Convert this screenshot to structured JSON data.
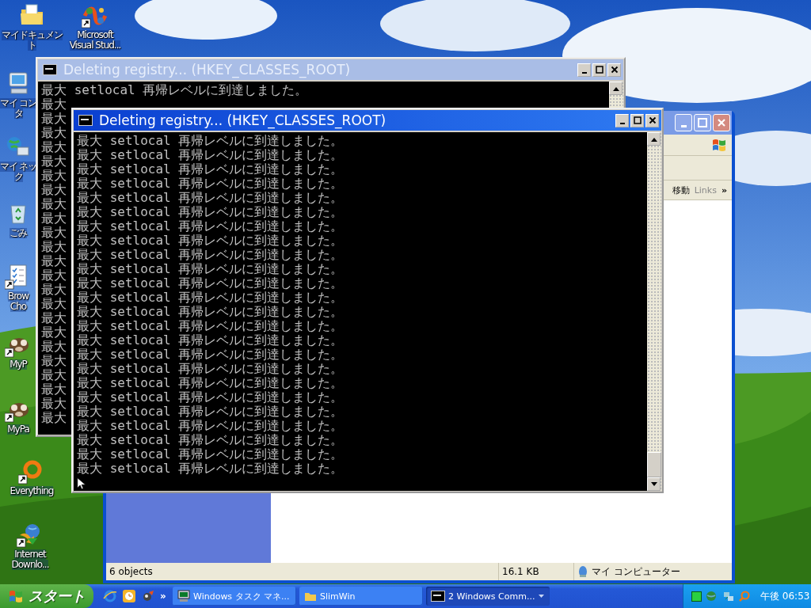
{
  "desktop_icons": [
    {
      "kind": "documents",
      "shortcut": false,
      "label_lines": [
        "マイドキュメン",
        "ト"
      ]
    },
    {
      "kind": "visual_studio",
      "shortcut": true,
      "label_lines": [
        "Microsoft",
        "Visual Stud..."
      ]
    },
    {
      "kind": "computer",
      "shortcut": false,
      "label_lines": [
        "マイ コン",
        "タ"
      ]
    },
    {
      "kind": "network",
      "shortcut": false,
      "label_lines": [
        "マイ ネッ",
        "ク"
      ]
    },
    {
      "kind": "recycle",
      "shortcut": false,
      "label_lines": [
        "ごみ"
      ]
    },
    {
      "kind": "checklist",
      "shortcut": true,
      "label_lines": [
        "Brow",
        "Cho"
      ]
    },
    {
      "kind": "animal",
      "shortcut": true,
      "label_lines": [
        "MyP"
      ]
    },
    {
      "kind": "animal",
      "shortcut": true,
      "label_lines": [
        "MyPa"
      ]
    },
    {
      "kind": "ring",
      "shortcut": true,
      "label_lines": [
        "Everything"
      ]
    },
    {
      "kind": "download",
      "shortcut": true,
      "label_lines": [
        "Internet",
        "Downlo..."
      ]
    }
  ],
  "explorer_window": {
    "active": false,
    "toolbar": [
      "移動",
      "Links",
      "»"
    ],
    "status_bar": [
      "6 objects",
      "16.1 KB",
      "マイ コンピューター"
    ]
  },
  "console_windows": [
    {
      "active": false,
      "title": "Deleting registry... (HKEY_CLASSES_ROOT)",
      "lines": [
        "最大 setlocal 再帰レベルに到達しました。",
        "最大",
        "最大",
        "最大",
        "最大",
        "最大",
        "最大",
        "最大",
        "最大",
        "最大",
        "最大",
        "最大",
        "最大",
        "最大",
        "最大",
        "最大",
        "最大",
        "最大",
        "最大",
        "最大",
        "最大",
        "最大",
        "最大",
        "最大"
      ]
    },
    {
      "active": true,
      "title": "Deleting registry... (HKEY_CLASSES_ROOT)",
      "lines": [
        "最大 setlocal 再帰レベルに到達しました。",
        "最大 setlocal 再帰レベルに到達しました。",
        "最大 setlocal 再帰レベルに到達しました。",
        "最大 setlocal 再帰レベルに到達しました。",
        "最大 setlocal 再帰レベルに到達しました。",
        "最大 setlocal 再帰レベルに到達しました。",
        "最大 setlocal 再帰レベルに到達しました。",
        "最大 setlocal 再帰レベルに到達しました。",
        "最大 setlocal 再帰レベルに到達しました。",
        "最大 setlocal 再帰レベルに到達しました。",
        "最大 setlocal 再帰レベルに到達しました。",
        "最大 setlocal 再帰レベルに到達しました。",
        "最大 setlocal 再帰レベルに到達しました。",
        "最大 setlocal 再帰レベルに到達しました。",
        "最大 setlocal 再帰レベルに到達しました。",
        "最大 setlocal 再帰レベルに到達しました。",
        "最大 setlocal 再帰レベルに到達しました。",
        "最大 setlocal 再帰レベルに到達しました。",
        "最大 setlocal 再帰レベルに到達しました。",
        "最大 setlocal 再帰レベルに到達しました。",
        "最大 setlocal 再帰レベルに到達しました。",
        "最大 setlocal 再帰レベルに到達しました。",
        "最大 setlocal 再帰レベルに到達しました。",
        "最大 setlocal 再帰レベルに到達しました。"
      ]
    }
  ],
  "taskbar": {
    "start_label": "スタート",
    "quick_launch_more": "»",
    "tasks": [
      {
        "kind": "monitor",
        "label": "Windows タスク マネ...",
        "selected": false,
        "grouped": false
      },
      {
        "kind": "folder",
        "label": "SlimWin",
        "selected": false,
        "grouped": false
      },
      {
        "kind": "console",
        "label": "2 Windows Comm...",
        "selected": true,
        "grouped": true
      }
    ],
    "clock": "午後 06:53"
  }
}
